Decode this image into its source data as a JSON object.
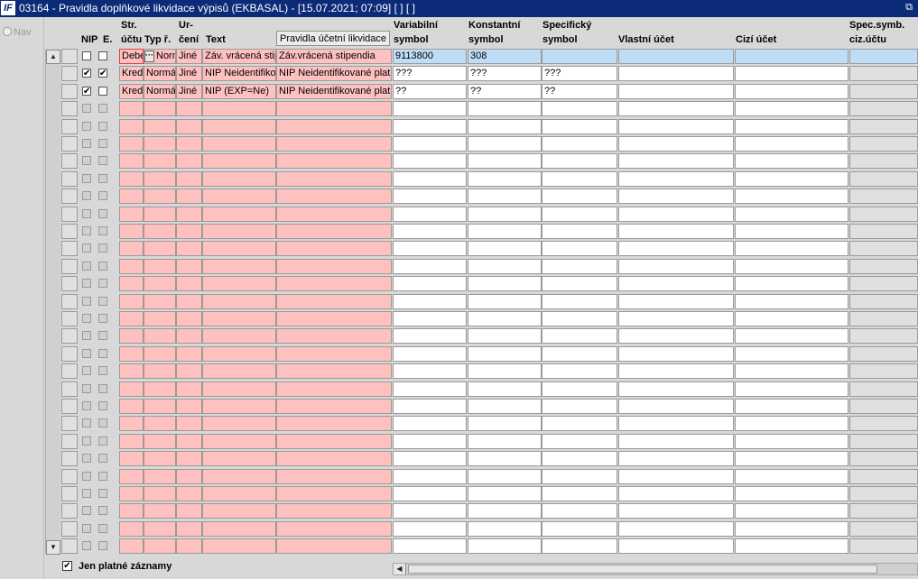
{
  "window": {
    "logo_text": "IF",
    "title": "03164 - Pravidla doplňkové likvidace výpisů (EKBASAL) - [15.07.2021; 07:09]  [ ]  [ ]",
    "restore_glyph": "⧉"
  },
  "left_panel": {
    "nav_label": "Nav"
  },
  "headers": {
    "nip": "NIP",
    "e": "E.",
    "str_uctu_1": "Str.",
    "str_uctu_2": "účtu",
    "typ": "Typ ř.",
    "urceni_1": "Ur-",
    "urceni_2": "čení",
    "text": "Text",
    "pravidla_button": "Pravidla účetní likvidace",
    "variabilni_1": "Variabilní",
    "variabilni_2": "symbol",
    "konstantni_1": "Konstantní",
    "konstantni_2": "symbol",
    "specificky_1": "Specifický",
    "specificky_2": "symbol",
    "vlastni_ucet": "Vlastní účet",
    "cizi_ucet": "Cizí účet",
    "spec_symb_1": "Spec.symb.",
    "spec_symb_2": "ciz.účtu"
  },
  "rows": [
    {
      "nip": false,
      "e": false,
      "str": "Debet",
      "typ": "Normál",
      "urceni": "Jiné",
      "text": "Záv. vrácená stipendia",
      "pravidla": "Záv.vrácená stipendia",
      "variabilni": "9113800",
      "konstantni": "308",
      "specificky": "",
      "vlastni": "",
      "cizi": "",
      "spec_ciz": ""
    },
    {
      "nip": true,
      "e": true,
      "str": "Kredit",
      "typ": "Normál",
      "urceni": "Jiné",
      "text": "NIP Neidentifikované platby",
      "pravidla": "NIP Neidentifikované platby",
      "variabilni": "???",
      "konstantni": "???",
      "specificky": "???",
      "vlastni": "",
      "cizi": "",
      "spec_ciz": ""
    },
    {
      "nip": true,
      "e": false,
      "str": "Kredit",
      "typ": "Normál",
      "urceni": "Jiné",
      "text": "NIP (EXP=Ne)",
      "pravidla": "NIP Neidentifikované platby",
      "variabilni": "??",
      "konstantni": "??",
      "specificky": "??",
      "vlastni": "",
      "cizi": "",
      "spec_ciz": ""
    }
  ],
  "empty_row_count": 26,
  "scroll": {
    "up": "▲",
    "down": "▼",
    "left": "◀"
  },
  "footer": {
    "only_valid_checked": true,
    "only_valid_label": "Jen platné záznamy"
  },
  "check_glyph": "✔",
  "ellipsis_glyph": "···",
  "colors": {
    "title_bar": "#0b2a78",
    "required_cell": "#ffc0c0",
    "selected_row": "#c0ddf8"
  }
}
